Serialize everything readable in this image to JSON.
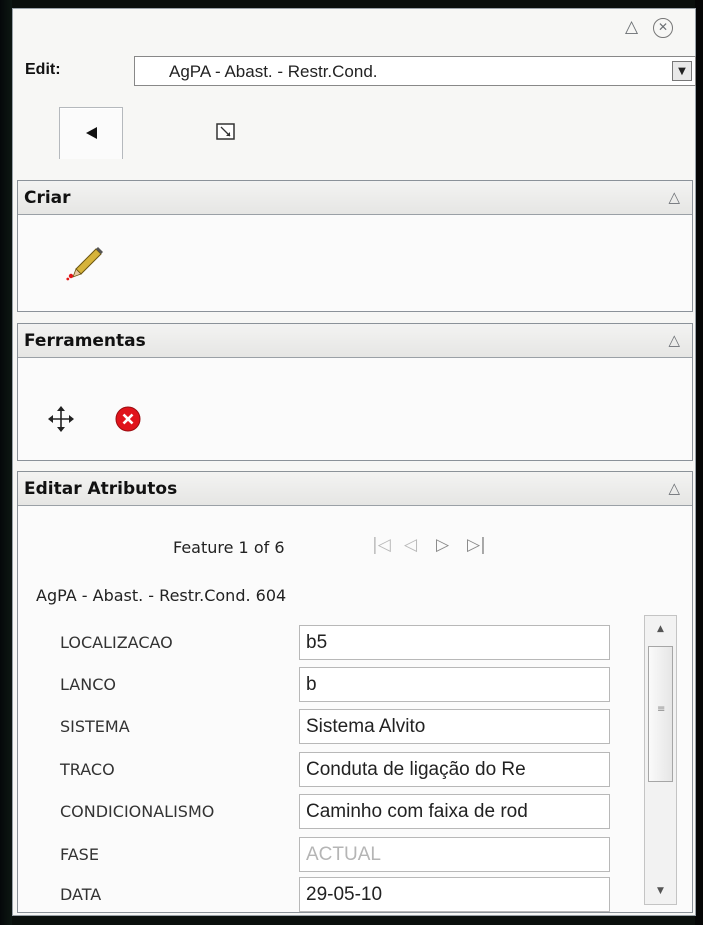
{
  "window": {
    "collapse_glyph": "△",
    "close_glyph": "✕"
  },
  "edit": {
    "label": "Edit:",
    "selected_layer": "AgPA - Abast. - Restr.Cond.",
    "dropdown_glyph": "▼"
  },
  "modes": [
    {
      "name": "select-arrow-icon"
    },
    {
      "name": "attribute-select-icon"
    }
  ],
  "sections": {
    "criar": {
      "title": "Criar",
      "collapse_glyph": "△",
      "tools": [
        "pencil-icon"
      ]
    },
    "ferramentas": {
      "title": "Ferramentas",
      "collapse_glyph": "△",
      "tools": [
        "move-icon",
        "delete-icon"
      ]
    },
    "editar_atributos": {
      "title": "Editar Atributos",
      "collapse_glyph": "△"
    }
  },
  "feature_nav": {
    "text": "Feature 1 of 6",
    "first": "|◁",
    "prev": "◁",
    "next": "▷",
    "last": "▷|"
  },
  "layer_feature_label": "AgPA - Abast. - Restr.Cond. 604",
  "attributes": [
    {
      "label": "LOCALIZACAO",
      "value": "b5",
      "disabled": false
    },
    {
      "label": "LANCO",
      "value": "b",
      "disabled": false
    },
    {
      "label": "SISTEMA",
      "value": "Sistema Alvito",
      "disabled": false
    },
    {
      "label": "TRACO",
      "value": "Conduta de ligação do Re",
      "disabled": false
    },
    {
      "label": "CONDICIONALISMO",
      "value": "Caminho com faixa de rod",
      "disabled": false
    },
    {
      "label": "FASE",
      "value": "ACTUAL",
      "disabled": true
    },
    {
      "label": "DATA",
      "value": "29-05-10",
      "disabled": false
    }
  ],
  "scrollbar": {
    "up": "▲",
    "down": "▼",
    "grip": "≡"
  }
}
